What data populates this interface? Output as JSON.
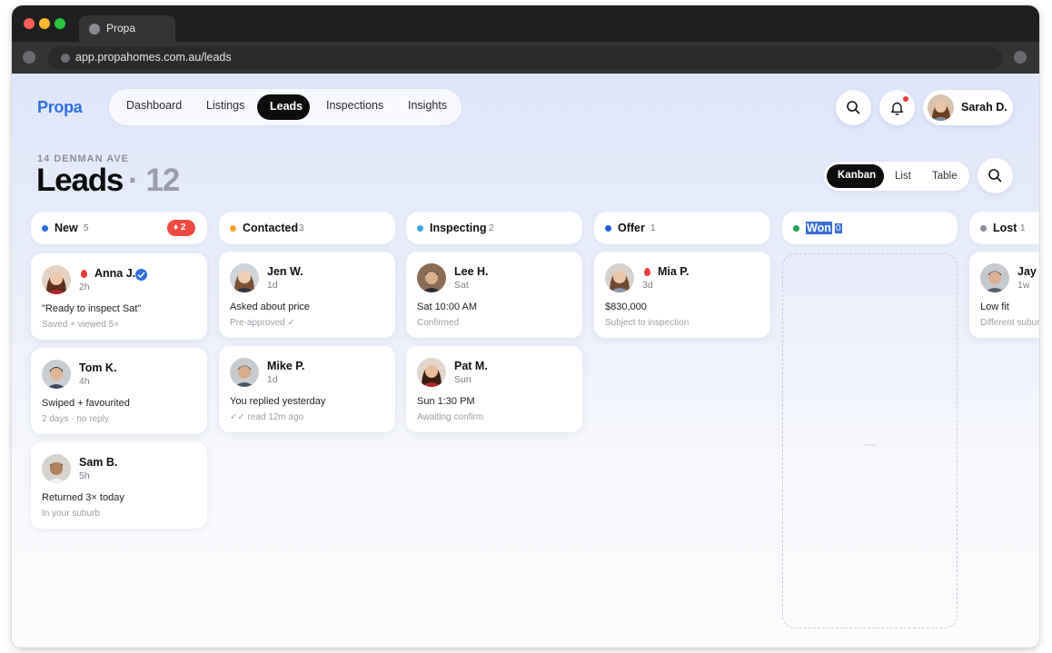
{
  "browser": {
    "tab_title": "Propa",
    "url": "app.propahomes.com.au/leads"
  },
  "app": {
    "logo": "Propa",
    "nav": [
      "Dashboard",
      "Listings",
      "Leads",
      "Inspections",
      "Insights"
    ],
    "active_nav": "Leads",
    "user_name": "Sarah D."
  },
  "page": {
    "eyebrow": "14 DENMAN AVE",
    "title": "Leads",
    "count": "· 12"
  },
  "views": {
    "active": "Kanban",
    "options": [
      "Kanban",
      "List",
      "Table"
    ]
  },
  "columns": [
    {
      "name": "New",
      "count": "5",
      "color": "#2f6fe0",
      "hot_badge": "♦ 2",
      "cards": [
        {
          "name": "Anna J.",
          "time": "2h",
          "line1": "\"Ready to inspect Sat\"",
          "line2": "Saved + viewed 5×",
          "hot": true,
          "verified": true
        },
        {
          "name": "Tom K.",
          "time": "4h",
          "line1": "Swiped + favourited",
          "line2": "2 days · no reply",
          "hot": false,
          "verified": false
        },
        {
          "name": "Sam B.",
          "time": "5h",
          "line1": "Returned 3× today",
          "line2": "In your suburb",
          "hot": false,
          "verified": false
        }
      ]
    },
    {
      "name": "Contacted",
      "count": "3",
      "color": "#f5a623",
      "cards": [
        {
          "name": "Jen W.",
          "time": "1d",
          "line1": "Asked about price",
          "line2": "Pre-approved ✓",
          "hot": false
        },
        {
          "name": "Mike P.",
          "time": "1d",
          "line1": "You replied yesterday",
          "line2": "✓✓ read 12m ago",
          "hot": false
        }
      ]
    },
    {
      "name": "Inspecting",
      "count": "2",
      "color": "#3aa7e8",
      "cards": [
        {
          "name": "Lee H.",
          "time": "Sat",
          "line1": "Sat 10:00 AM",
          "line2": "Confirmed",
          "hot": false
        },
        {
          "name": "Pat M.",
          "time": "Sun",
          "line1": "Sun 1:30 PM",
          "line2": "Awaiting confirm",
          "hot": false
        }
      ]
    },
    {
      "name": "Offer",
      "count": "1",
      "color": "#1f5fe0",
      "cards": [
        {
          "name": "Mia P.",
          "time": "3d",
          "line1": "$830,000",
          "line2": "Subject to inspection",
          "hot": true
        }
      ]
    },
    {
      "name": "Won",
      "count": "0",
      "color": "#22a45a",
      "empty_placeholder": "—",
      "cards": []
    },
    {
      "name": "Lost",
      "count": "1",
      "color": "#8a8e99",
      "cards": [
        {
          "name": "Jay",
          "time": "1w",
          "line1": "Low fit",
          "line2": "Different subur",
          "hot": false
        }
      ]
    }
  ],
  "colors": {
    "accent": "#2f6fe0",
    "hot": "#ef3b3b",
    "background_top": "#dfe6fa"
  }
}
